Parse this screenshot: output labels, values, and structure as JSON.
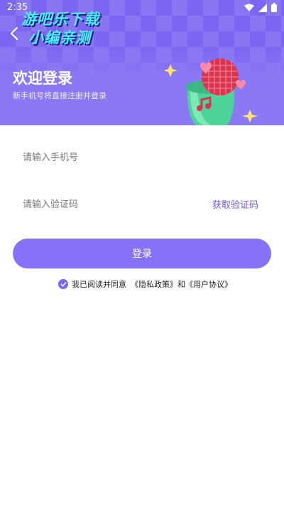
{
  "status": {
    "time": "2:35"
  },
  "watermark": {
    "line1": "游吧乐下载",
    "line2": "小编亲测"
  },
  "header": {
    "title": "欢迎登录",
    "subtitle": "新手机号将直接注册并登录"
  },
  "form": {
    "phone_placeholder": "请输入手机号",
    "code_placeholder": "请输入验证码",
    "get_code_label": "获取验证码",
    "login_label": "登录"
  },
  "agreement": {
    "prefix": "我已阅读并同意",
    "privacy_link": "《隐私政策》",
    "conjunction": "和",
    "user_link": "《用户协议》",
    "checked": true
  },
  "colors": {
    "accent": "#8572f6",
    "header_bg": "#8b78f5",
    "link": "#6b57e6"
  }
}
